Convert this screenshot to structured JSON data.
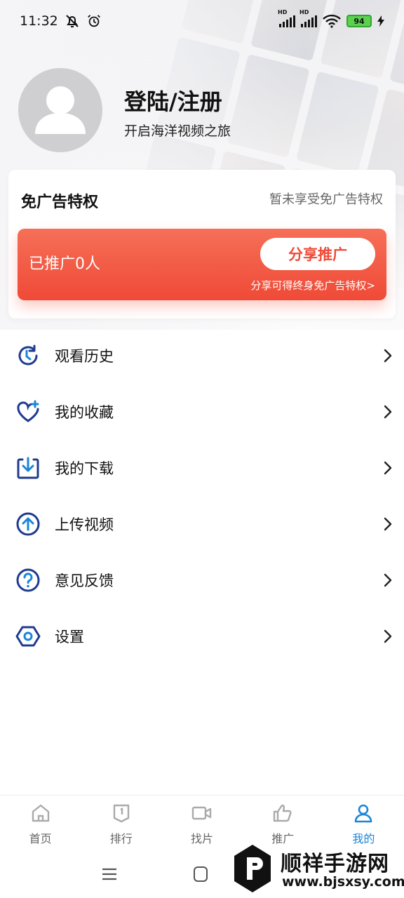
{
  "status_bar": {
    "time": "11:32",
    "battery_level": "94",
    "signal_label_1": "HD",
    "signal_label_2": "HD"
  },
  "profile": {
    "title": "登陆/注册",
    "subtitle": "开启海洋视频之旅"
  },
  "adfree": {
    "title": "免广告特权",
    "status": "暂未享受免广告特权",
    "promoted_count": "已推广0人",
    "share_button": "分享推广",
    "hint": "分享可得终身免广告特权>"
  },
  "menu": {
    "items": [
      {
        "label": "观看历史",
        "icon": "history-icon"
      },
      {
        "label": "我的收藏",
        "icon": "heart-plus-icon"
      },
      {
        "label": "我的下载",
        "icon": "download-icon"
      },
      {
        "label": "上传视频",
        "icon": "upload-icon"
      },
      {
        "label": "意见反馈",
        "icon": "help-icon"
      },
      {
        "label": "设置",
        "icon": "settings-icon"
      }
    ]
  },
  "tabs": [
    {
      "label": "首页",
      "icon": "home-icon"
    },
    {
      "label": "排行",
      "icon": "ranking-icon"
    },
    {
      "label": "找片",
      "icon": "video-camera-icon"
    },
    {
      "label": "推广",
      "icon": "thumbs-up-icon"
    },
    {
      "label": "我的",
      "icon": "user-icon",
      "active": true
    }
  ],
  "watermark": {
    "name": "顺祥手游网",
    "url": "www.bjsxsy.com"
  },
  "colors": {
    "accent_blue": "#1a86d8",
    "icon_navy": "#1f3b8f",
    "promo_red": "#ef4a37"
  }
}
